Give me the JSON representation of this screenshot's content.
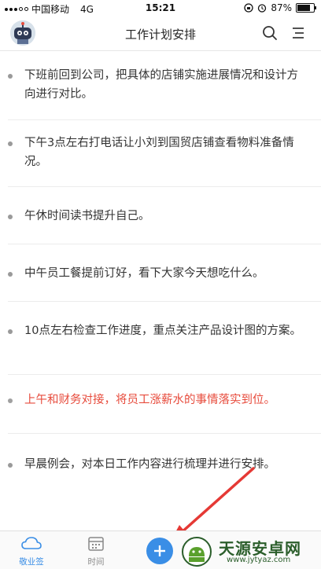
{
  "status": {
    "carrier": "中国移动",
    "network": "4G",
    "time": "15:21",
    "battery_percent": "87%",
    "battery_level": 0.87
  },
  "header": {
    "title": "工作计划安排",
    "search_icon": "search-icon",
    "menu_icon": "menu-icon"
  },
  "items": [
    {
      "text": "下班前回到公司，把具体的店铺实施进展情况和设计方向进行对比。",
      "color": "#333333"
    },
    {
      "text": "下午3点左右打电话让小刘到国贸店铺查看物料准备情况。",
      "color": "#333333"
    },
    {
      "text": "午休时间读书提升自己。",
      "color": "#333333"
    },
    {
      "text": "中午员工餐提前订好，看下大家今天想吃什么。",
      "color": "#333333"
    },
    {
      "text": "10点左右检查工作进度，重点关注产品设计图的方案。",
      "color": "#333333"
    },
    {
      "text": "上午和财务对接，将员工涨薪水的事情落实到位。",
      "color": "#e74b3c"
    },
    {
      "text": "早晨例会，对本日工作内容进行梳理并进行安排。",
      "color": "#333333"
    }
  ],
  "nav": {
    "tab1_label": "敬业签",
    "tab2_label": "时间"
  },
  "watermark": {
    "name": "天源安卓网",
    "url": "www.jytyaz.com"
  },
  "colors": {
    "accent": "#3a8ee6",
    "arrow": "#e53935"
  }
}
